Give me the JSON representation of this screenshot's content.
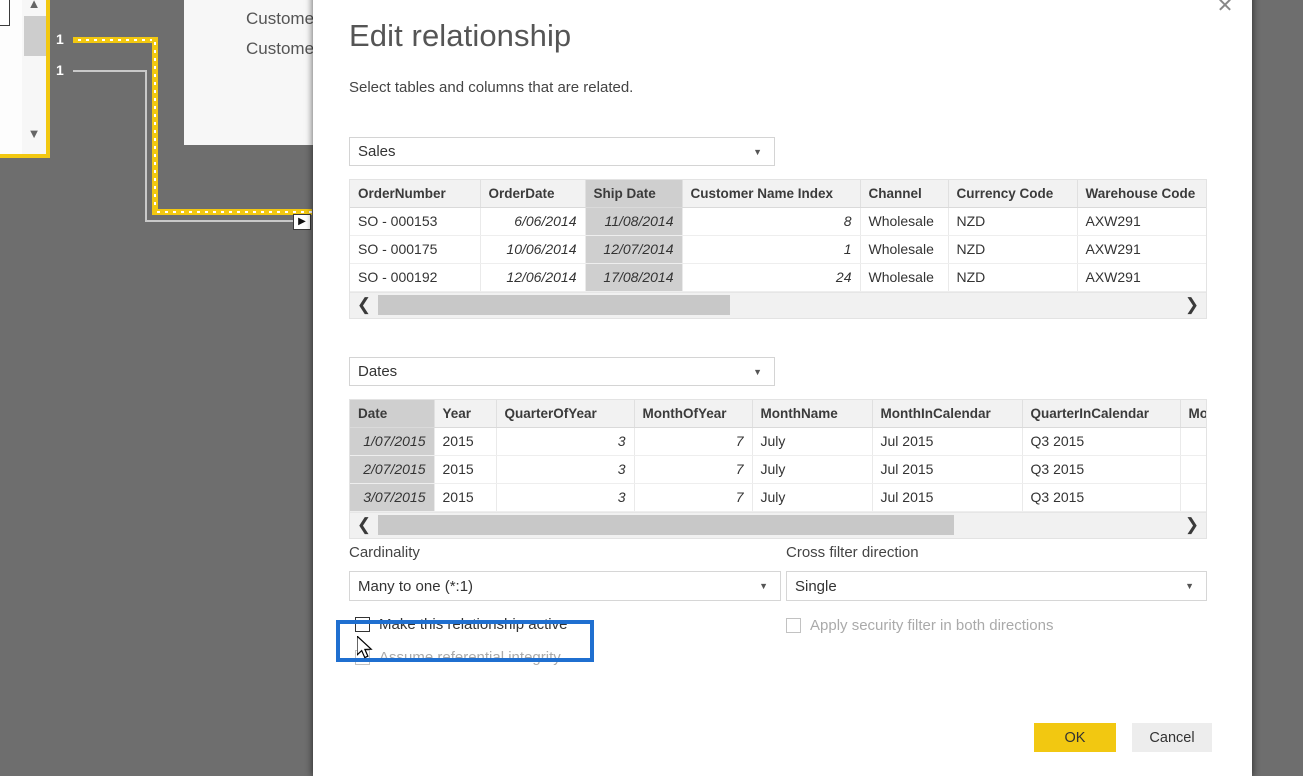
{
  "background": {
    "canvas_color": "#6e6e6e",
    "selected_relationship_color": "#f2c811",
    "cardinality_labels": [
      "1",
      "1"
    ],
    "table_card_rows": [
      "Custome",
      "Custome"
    ],
    "relationship_arrow_icon": "arrow-right-icon"
  },
  "dialog": {
    "title": "Edit relationship",
    "subtitle": "Select tables and columns that are related.",
    "close_icon": "close-icon",
    "caret_icon": "chevron-down-icon",
    "focus_ring_color": "#1f6fd0"
  },
  "from_table": {
    "selected": "Sales",
    "selected_column": "Ship Date",
    "columns": [
      "OrderNumber",
      "OrderDate",
      "Ship Date",
      "Customer Name Index",
      "Channel",
      "Currency Code",
      "Warehouse Code"
    ],
    "rows": [
      [
        "SO - 000153",
        "6/06/2014",
        "11/08/2014",
        "8",
        "Wholesale",
        "NZD",
        "AXW291"
      ],
      [
        "SO - 000175",
        "10/06/2014",
        "12/07/2014",
        "1",
        "Wholesale",
        "NZD",
        "AXW291"
      ],
      [
        "SO - 000192",
        "12/06/2014",
        "17/08/2014",
        "24",
        "Wholesale",
        "NZD",
        "AXW291"
      ]
    ],
    "scroll_left_icon": "chevron-left-icon",
    "scroll_right_icon": "chevron-right-icon"
  },
  "to_table": {
    "selected": "Dates",
    "selected_column": "Date",
    "columns": [
      "Date",
      "Year",
      "QuarterOfYear",
      "MonthOfYear",
      "MonthName",
      "MonthInCalendar",
      "QuarterInCalendar",
      "Mo"
    ],
    "rows": [
      [
        "1/07/2015",
        "2015",
        "3",
        "7",
        "July",
        "Jul 2015",
        "Q3 2015",
        ""
      ],
      [
        "2/07/2015",
        "2015",
        "3",
        "7",
        "July",
        "Jul 2015",
        "Q3 2015",
        ""
      ],
      [
        "3/07/2015",
        "2015",
        "3",
        "7",
        "July",
        "Jul 2015",
        "Q3 2015",
        ""
      ]
    ],
    "scroll_left_icon": "chevron-left-icon",
    "scroll_right_icon": "chevron-right-icon"
  },
  "options": {
    "cardinality_label": "Cardinality",
    "cardinality_value": "Many to one (*:1)",
    "cross_filter_label": "Cross filter direction",
    "cross_filter_value": "Single",
    "make_active_label": "Make this relationship active",
    "make_active_checked": false,
    "assume_ri_label": "Assume referential integrity",
    "assume_ri_checked": false,
    "assume_ri_disabled": true,
    "apply_security_label": "Apply security filter in both directions",
    "apply_security_checked": false,
    "apply_security_disabled": true
  },
  "footer": {
    "ok_label": "OK",
    "cancel_label": "Cancel",
    "ok_color": "#f2c811"
  }
}
